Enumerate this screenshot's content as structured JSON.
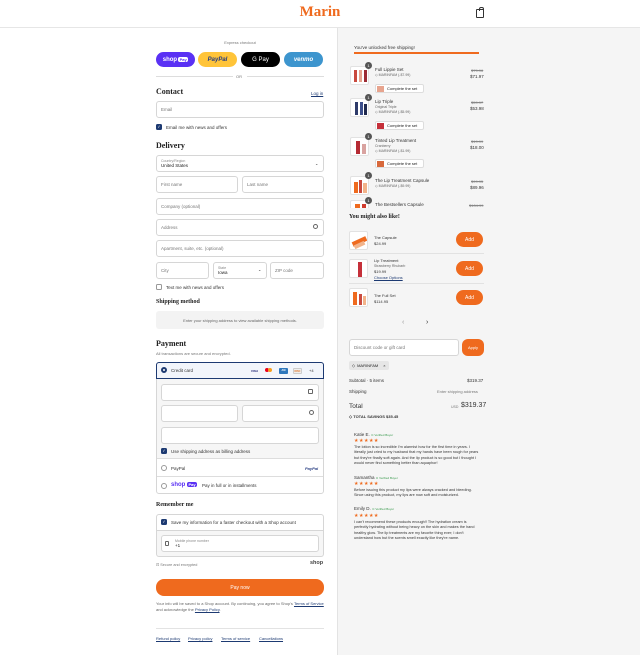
{
  "brand": "Marin",
  "express": {
    "label": "Express checkout",
    "shoppay": "shop",
    "shoppay_badge": "Pay",
    "paypal": "PayPal",
    "gpay": "G Pay",
    "venmo": "venmo",
    "or": "OR"
  },
  "contact": {
    "title": "Contact",
    "login": "Log in",
    "email_placeholder": "Email",
    "news_label": "Email me with news and offers"
  },
  "delivery": {
    "title": "Delivery",
    "country_label": "Country/Region",
    "country_value": "United States",
    "first_name": "First name",
    "last_name": "Last name",
    "company": "Company (optional)",
    "address": "Address",
    "apartment": "Apartment, suite, etc. (optional)",
    "city": "City",
    "state_label": "State",
    "state_value": "Iowa",
    "zip": "ZIP code",
    "text_label": "Text me with news and offers"
  },
  "shipping": {
    "title": "Shipping method",
    "message": "Enter your shipping address to view available shipping methods."
  },
  "payment": {
    "title": "Payment",
    "subtitle": "All transactions are secure and encrypted.",
    "credit_card": "Credit card",
    "more_cards": "+4",
    "billing_label": "Use shipping address as billing address",
    "paypal": "PayPal",
    "shoppay_label": "Pay in full or in installments",
    "shop": "shop",
    "shop_badge": "Pay"
  },
  "remember": {
    "title": "Remember me",
    "save_label": "Save my information for a faster checkout with a Shop account",
    "phone_label": "Mobile phone number",
    "phone_prefix": "+1",
    "secure": "Secure and encrypted",
    "shop": "shop"
  },
  "pay_now": "Pay now",
  "legal": {
    "text1": "Your info will be saved to a Shop account. By continuing, you agree to Shop's",
    "terms": "Terms of Service",
    "text2": "and acknowledge the",
    "privacy": "Privacy Policy",
    "period": "."
  },
  "footer": [
    "Refund policy",
    "Privacy policy",
    "Terms of service",
    "Cancellations"
  ],
  "free_shipping": "You've unlocked free shipping!",
  "progress_fraction": 1.0,
  "cart": [
    {
      "qty": "1",
      "name": "Full Lippie Set",
      "variant": "",
      "discount": "MARINFAM (-$7.99)",
      "old": "$79.96",
      "price": "$71.97",
      "button": "Complete the set"
    },
    {
      "qty": "1",
      "name": "Lip Triple",
      "variant": "Original Triple",
      "discount": "MARINFAM (-$5.99)",
      "old": "$59.97",
      "price": "$53.98",
      "button": "Complete the set"
    },
    {
      "qty": "1",
      "name": "Tinted Lip Treatment",
      "variant": "Cranberry",
      "discount": "MARINFAM (-$1.99)",
      "old": "$19.99",
      "price": "$18.00",
      "button": "Complete the set"
    },
    {
      "qty": "1",
      "name": "The Lip Treatment Capsule",
      "variant": "",
      "discount": "MARINFAM (-$9.99)",
      "old": "$99.95",
      "price": "$89.96",
      "button": ""
    },
    {
      "qty": "1",
      "name": "The Bestsellers Capsule",
      "variant": "",
      "discount": "",
      "old": "$104.99",
      "price": "",
      "button": ""
    }
  ],
  "upsell": {
    "title": "You might also like!",
    "items": [
      {
        "name": "The Capsule",
        "variant": "",
        "price": "$24.99",
        "option": "",
        "button": "Add"
      },
      {
        "name": "Lip Treatment",
        "variant": "Strawberry Rhubarb",
        "price": "$19.99",
        "option": "Choose Options",
        "button": "Add"
      },
      {
        "name": "The Full Set",
        "variant": "",
        "price": "$114.95",
        "option": "",
        "button": "Add"
      }
    ],
    "prev": "‹",
    "next": "›"
  },
  "discount": {
    "placeholder": "Discount code or gift card",
    "apply": "Apply",
    "code": "MARINFAM",
    "remove": "×"
  },
  "totals": {
    "subtotal_label": "Subtotal · 5 items",
    "subtotal": "$319.37",
    "shipping_label": "Shipping",
    "shipping_value": "Enter shipping address",
    "total_label": "Total",
    "currency": "USD",
    "total": "$319.37",
    "savings_label": "TOTAL SAVINGS",
    "savings": "$35.45"
  },
  "reviews": [
    {
      "name": "Katie E.",
      "verified": "Verified Buyer",
      "stars": "★★★★★",
      "text": "The lotion is so incredible I'm alarmist how for the first time in years. I literally just cried to my husband that my hands have been rough for years but they're finally soft again. And the lip product is so good but I thought I would never find something better than aquaphor!"
    },
    {
      "name": "Samantha",
      "verified": "Verified Buyer",
      "stars": "★★★★★",
      "text": "Before issuing this product my lips were always cracked and bleeding. Since using this product, my lips are now soft and moisturized."
    },
    {
      "name": "Emily D.",
      "verified": "Verified Buyer",
      "stars": "★★★★★",
      "text": "I can't recommend these products enough!! The hydration cream is perfectly hydrating without being heavy on the skin and makes the hand healthy glow. The lip treatments are my favorite thing ever; I don't understand how but the scents smell exactly like they're name."
    }
  ],
  "colors": {
    "accent": "#ef6a1e",
    "navy": "#1d3a72",
    "shoppay": "#5a31f4",
    "paypal": "#ffc439",
    "venmo": "#3d95ce"
  }
}
